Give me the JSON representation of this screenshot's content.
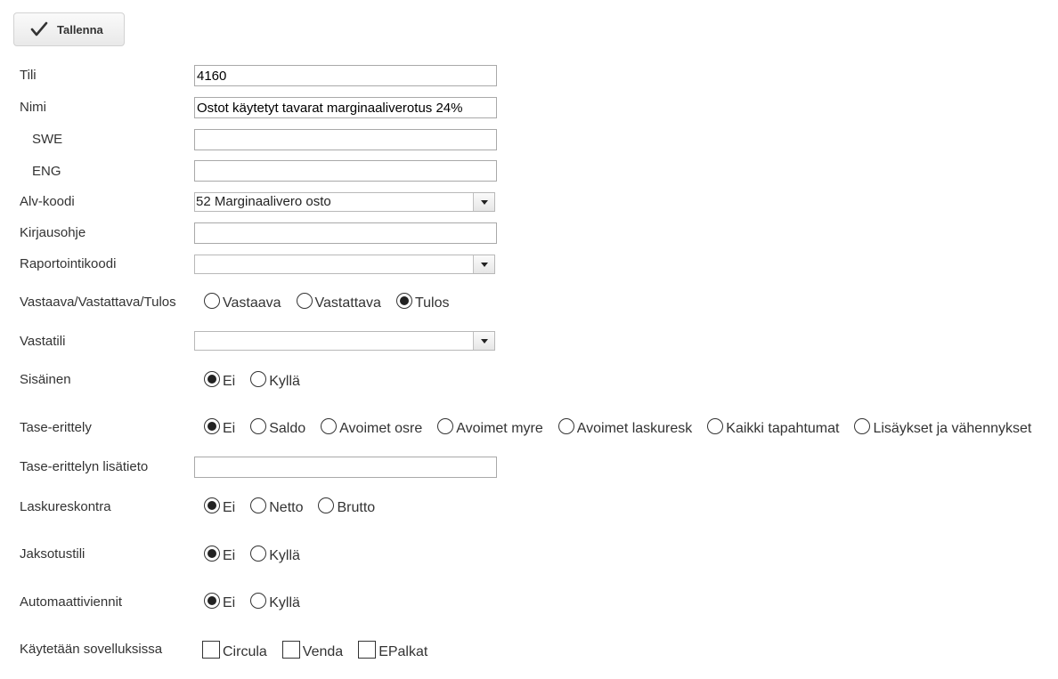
{
  "toolbar": {
    "save_label": "Tallenna"
  },
  "fields": {
    "tili": {
      "label": "Tili",
      "value": "4160"
    },
    "nimi": {
      "label": "Nimi",
      "value": "Ostot käytetyt tavarat marginaaliverotus 24%"
    },
    "swe": {
      "label": "SWE",
      "value": ""
    },
    "eng": {
      "label": "ENG",
      "value": ""
    },
    "alv_koodi": {
      "label": "Alv-koodi",
      "value": "52 Marginaalivero osto"
    },
    "kirjausohje": {
      "label": "Kirjausohje",
      "value": ""
    },
    "raportointikoodi": {
      "label": "Raportointikoodi",
      "value": ""
    },
    "vastaava_tyyppi": {
      "label": "Vastaava/Vastattava/Tulos",
      "options": [
        "Vastaava",
        "Vastattava",
        "Tulos"
      ],
      "selected": "Tulos"
    },
    "vastatili": {
      "label": "Vastatili",
      "value": ""
    },
    "sisainen": {
      "label": "Sisäinen",
      "options": [
        "Ei",
        "Kyllä"
      ],
      "selected": "Ei"
    },
    "tase_erittely": {
      "label": "Tase-erittely",
      "options": [
        "Ei",
        "Saldo",
        "Avoimet osre",
        "Avoimet myre",
        "Avoimet laskuresk",
        "Kaikki tapahtumat",
        "Lisäykset ja vähennykset"
      ],
      "selected": "Ei"
    },
    "tase_lisatieto": {
      "label": "Tase-erittelyn lisätieto",
      "value": ""
    },
    "laskureskontra": {
      "label": "Laskureskontra",
      "options": [
        "Ei",
        "Netto",
        "Brutto"
      ],
      "selected": "Ei"
    },
    "jaksotustili": {
      "label": "Jaksotustili",
      "options": [
        "Ei",
        "Kyllä"
      ],
      "selected": "Ei"
    },
    "automaattiviennit": {
      "label": "Automaattiviennit",
      "options": [
        "Ei",
        "Kyllä"
      ],
      "selected": "Ei"
    },
    "sovellukset": {
      "label": "Käytetään sovelluksissa",
      "options": [
        "Circula",
        "Venda",
        "EPalkat"
      ],
      "checked": []
    }
  }
}
